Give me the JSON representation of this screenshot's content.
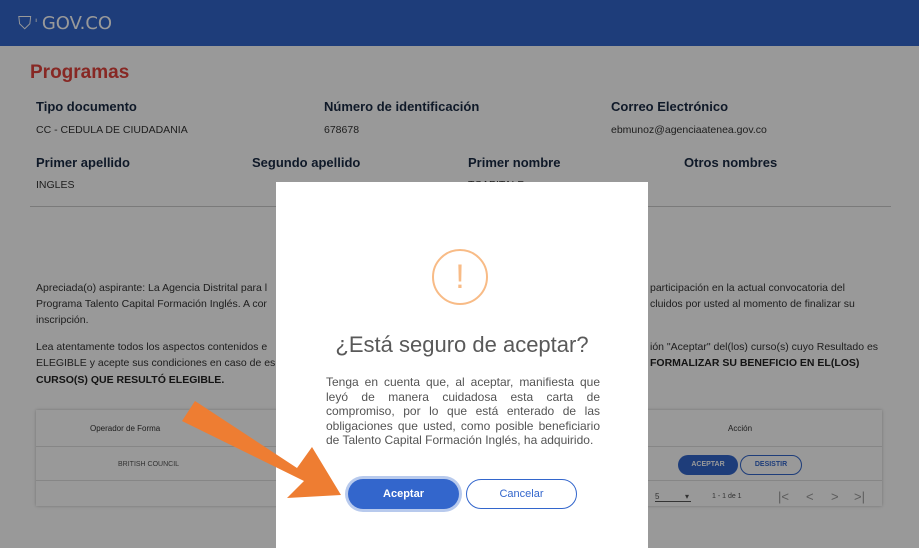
{
  "header": {
    "logo_text": "GOV.CO",
    "brand_color": "#3366cc"
  },
  "page": {
    "title": "Programas",
    "title_color": "#e1443d"
  },
  "profile": {
    "tipo_documento_label": "Tipo documento",
    "tipo_documento_value": "CC - CEDULA DE CIUDADANIA",
    "numero_label": "Número de identificación",
    "numero_value": "678678",
    "correo_label": "Correo Electrónico",
    "correo_value": "ebmunoz@agenciaatenea.gov.co",
    "primer_apellido_label": "Primer apellido",
    "primer_apellido_value": "INGLES",
    "segundo_apellido_label": "Segundo apellido",
    "primer_nombre_label": "Primer nombre",
    "primer_nombre_value": "TCAPITALF",
    "otros_nombres_label": "Otros nombres"
  },
  "body_text": {
    "p1_l1_left": "Apreciada(o) aspirante: La Agencia Distrital para l",
    "p1_l1_right": "participación en la actual convocatoria del",
    "p1_l2_left": "Programa Talento Capital Formación Inglés. A cor",
    "p1_l2_right": "cluidos por usted al momento de finalizar su",
    "p1_l3": "inscripción.",
    "p2_l1_left": "Lea atentamente todos los aspectos contenidos e",
    "p2_l1_right": "ión \"Aceptar\" del(los) curso(s) cuyo Resultado es",
    "p2_l2_left": "ELEGIBLE y acepte sus condiciones en caso de es",
    "p2_l2_right": "FORMALIZAR SU BENEFICIO EN EL(LOS)",
    "p2_l3": "CURSO(S) QUE RESULTÓ ELEGIBLE."
  },
  "table": {
    "col_operador": "Operador de Forma",
    "col_accion": "Acción",
    "row_operador": "BRITISH COUNCIL",
    "btn_aceptar": "ACEPTAR",
    "btn_desistir": "DESISTIR",
    "page_size": "5",
    "range": "1 - 1 de 1"
  },
  "modal": {
    "icon": "!",
    "title": "¿Está seguro de aceptar?",
    "body": "Tenga en cuenta que, al aceptar, manifiesta que leyó de manera cuidadosa esta carta de compromiso, por lo que está enterado de las obligaciones que usted, como posible beneficiario de Talento Capital Formación Inglés, ha adquirido.",
    "accept_label": "Aceptar",
    "cancel_label": "Cancelar"
  },
  "annotation": {
    "arrow_color": "#ee7d32"
  }
}
